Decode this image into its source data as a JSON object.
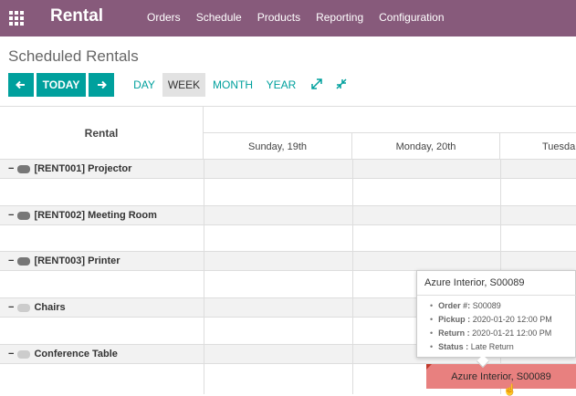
{
  "app": {
    "name": "Rental"
  },
  "menu": [
    "Orders",
    "Schedule",
    "Products",
    "Reporting",
    "Configuration"
  ],
  "breadcrumb": "Scheduled Rentals",
  "controls": {
    "today": "TODAY",
    "scales": [
      "DAY",
      "WEEK",
      "MONTH",
      "YEAR"
    ],
    "active_scale": "WEEK"
  },
  "grid": {
    "left_header": "Rental",
    "days": [
      "Sunday, 19th",
      "Monday, 20th",
      "Tuesda"
    ],
    "groups": [
      {
        "label": "[RENT001] Projector"
      },
      {
        "label": "[RENT002] Meeting Room"
      },
      {
        "label": "[RENT003] Printer"
      },
      {
        "label": "Chairs"
      },
      {
        "label": "Conference Table"
      }
    ]
  },
  "pill": {
    "label": "Azure Interior, S00089"
  },
  "popover": {
    "title": "Azure Interior, S00089",
    "fields": [
      {
        "key": "Order #:",
        "value": "S00089"
      },
      {
        "key": "Pickup :",
        "value": "2020-01-20 12:00 PM"
      },
      {
        "key": "Return :",
        "value": "2020-01-21 12:00 PM"
      },
      {
        "key": "Status :",
        "value": "Late Return"
      }
    ]
  }
}
